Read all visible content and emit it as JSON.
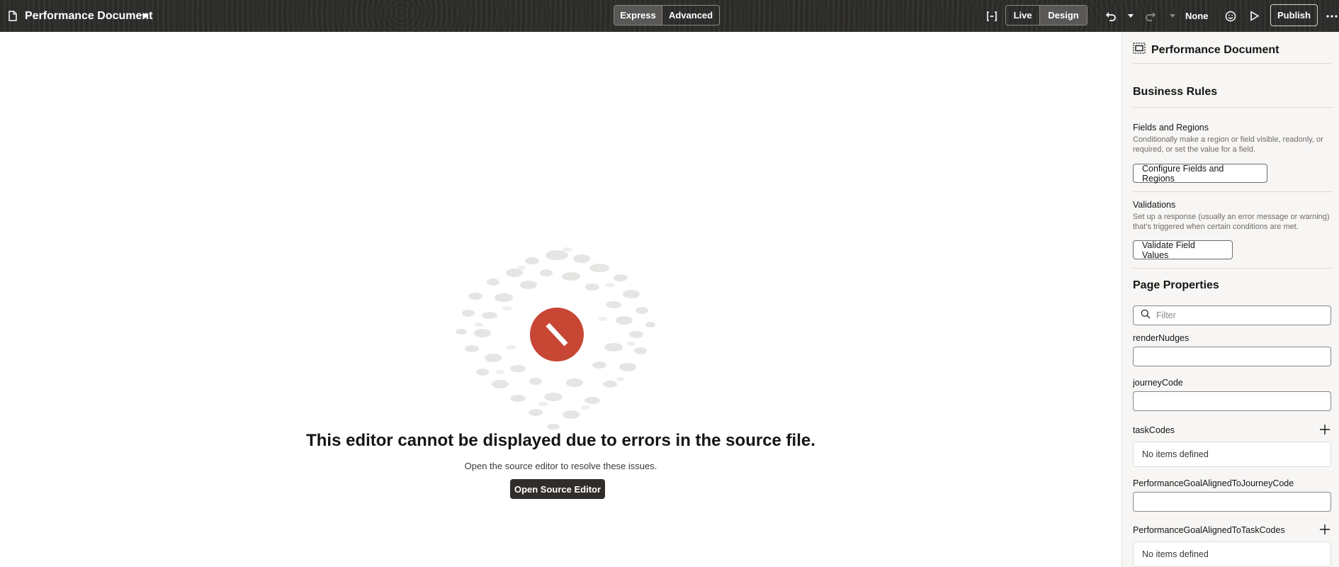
{
  "topbar": {
    "doc_title": "Performance Document",
    "mode_options": [
      "Express",
      "Advanced"
    ],
    "mode_selected": "Express",
    "view_options": [
      "Live",
      "Design"
    ],
    "view_selected": "Design",
    "zoom_value": "None",
    "publish_label": "Publish",
    "icons": [
      "document-icon",
      "caret-down-icon",
      "bracket-icon",
      "undo-icon",
      "redo-icon",
      "smiley-icon",
      "play-icon",
      "more-icon"
    ]
  },
  "main": {
    "error_title": "This editor cannot be displayed due to errors in the source file.",
    "error_subtitle": "Open the source editor to resolve these issues.",
    "open_button": "Open Source Editor"
  },
  "panel": {
    "header_title": "Performance Document",
    "business_rules_title": "Business Rules",
    "fields_regions_title": "Fields and Regions",
    "fields_regions_desc": "Conditionally make a region or field visible, readonly, or required, or set the value for a field.",
    "fields_regions_button": "Configure Fields and Regions",
    "validations_title": "Validations",
    "validations_desc": "Set up a response (usually an error message or warning) that's triggered when certain conditions are met.",
    "validations_button": "Validate Field Values",
    "page_properties_title": "Page Properties",
    "filter_placeholder": "Filter",
    "props": {
      "render_nudges": "renderNudges",
      "journey_code": "journeyCode",
      "task_codes": "taskCodes",
      "task_codes_empty": "No items defined",
      "goal_journey_code": "PerformanceGoalAlignedToJourneyCode",
      "goal_task_codes": "PerformanceGoalAlignedToTaskCodes",
      "goal_task_codes_empty": "No items defined"
    }
  },
  "colors": {
    "topbar_bg": "#2b2a28",
    "error_icon": "#c74634",
    "primary_button": "#312d2a",
    "panel_bg": "#f7f6f5"
  }
}
